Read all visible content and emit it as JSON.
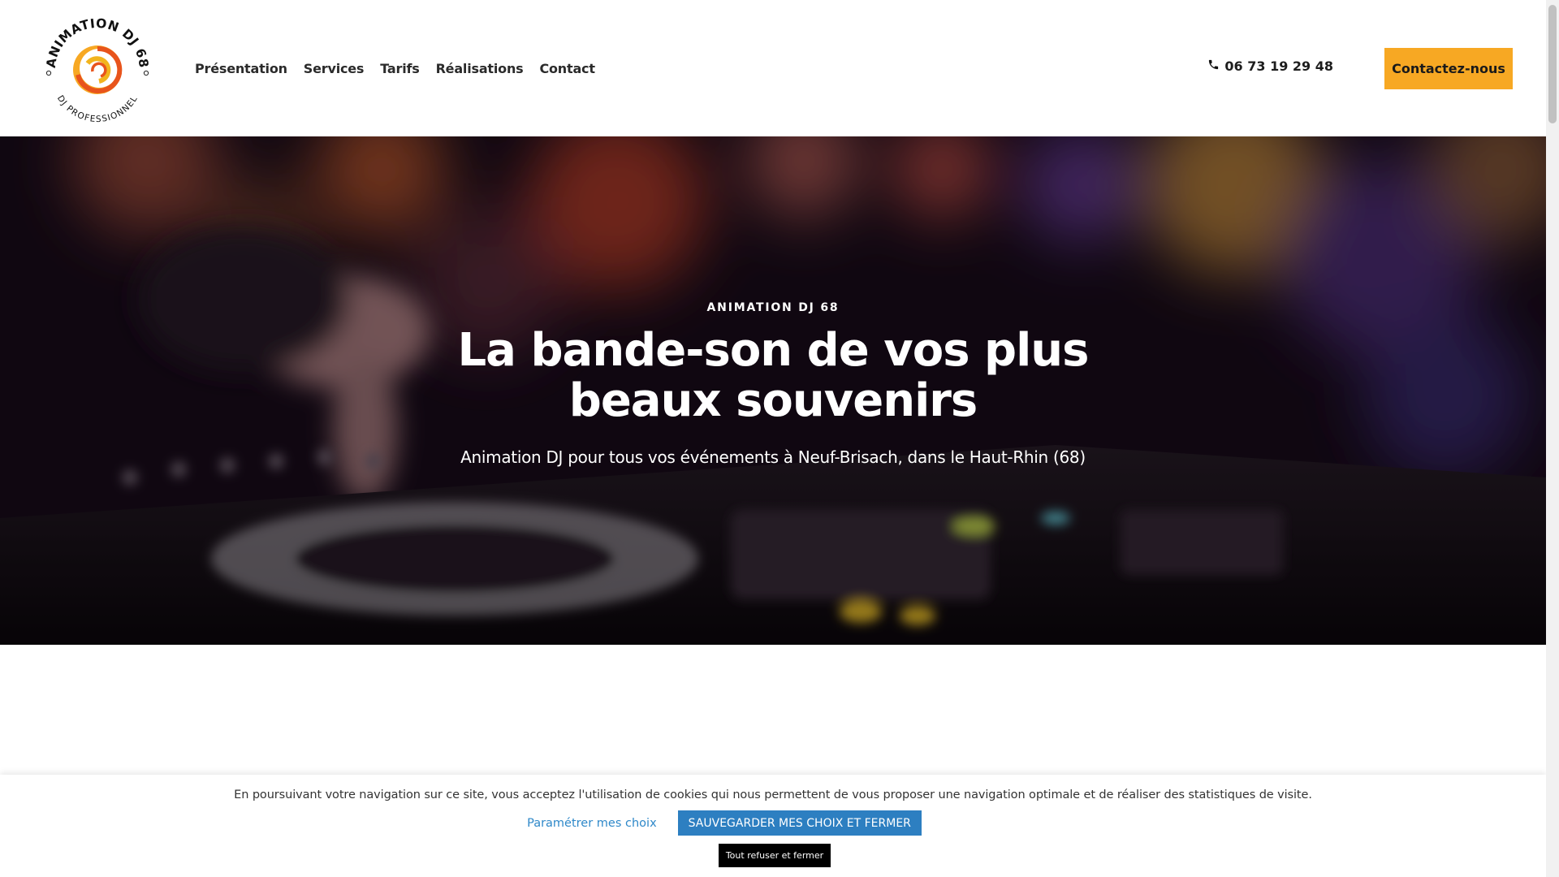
{
  "header": {
    "logo": {
      "arc_top_text": "ANIMATION DJ 68",
      "arc_bottom_text": "DJ PROFESSIONNEL"
    },
    "nav": [
      {
        "label": "Présentation"
      },
      {
        "label": "Services"
      },
      {
        "label": "Tarifs"
      },
      {
        "label": "Réalisations"
      },
      {
        "label": "Contact"
      }
    ],
    "phone": "06 73 19 29 48",
    "cta_label": "Contactez-nous"
  },
  "hero": {
    "eyebrow": "ANIMATION DJ 68",
    "title": "La bande-son de vos plus beaux souvenirs",
    "subtitle": "Animation DJ pour tous vos événements à Neuf-Brisach, dans le Haut-Rhin (68)"
  },
  "cookie_banner": {
    "message": "En poursuivant votre navigation sur ce site, vous acceptez l'utilisation de cookies qui nous permettent de vous proposer une navigation optimale et de réaliser des statistiques de visite.",
    "settings_link": "Paramétrer mes choix",
    "save_button": "SAUVEGARDER MES CHOIX ET FERMER",
    "refuse_button": "Tout refuser et fermer"
  },
  "colors": {
    "accent": "#f7a823",
    "cookie_blue": "#2d7fc1",
    "link_blue": "#2e88c9"
  },
  "icons": {
    "phone": "phone-icon"
  }
}
